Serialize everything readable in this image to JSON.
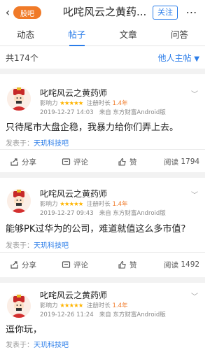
{
  "header": {
    "back_icon": "‹",
    "app_name": "股吧",
    "title": "叱咤风云之黄药...",
    "follow_label": "关注",
    "more_icon": "⋯"
  },
  "tabs": [
    "动态",
    "帖子",
    "文章",
    "问答"
  ],
  "active_tab": 1,
  "count_text": "共174个",
  "others_text": "他人主帖",
  "posts": [
    {
      "username": "叱咤风云之黄药师",
      "influence_label": "影响力",
      "stars": "★★★★★",
      "register_label": "注册时长",
      "register_value": "1.4年",
      "datetime": "2019-12-27 14:03",
      "source": "来自 东方财富Android版",
      "content": "只待尾市大盘企稳，我暴力给你们弄上去。",
      "from_label": "发表于：",
      "bar_name": "天玑科技吧",
      "share_label": "分享",
      "comment_label": "评论",
      "like_label": "赞",
      "read_label": "阅读",
      "read_count": "1794"
    },
    {
      "username": "叱咤风云之黄药师",
      "influence_label": "影响力",
      "stars": "★★★★★",
      "register_label": "注册时长",
      "register_value": "1.4年",
      "datetime": "2019-12-27 09:43",
      "source": "来自 东方财富Android版",
      "content": "能够PK过华为的公司，难道就值这么多市值?",
      "from_label": "发表于：",
      "bar_name": "天玑科技吧",
      "share_label": "分享",
      "comment_label": "评论",
      "like_label": "赞",
      "read_label": "阅读",
      "read_count": "1492"
    },
    {
      "username": "叱咤风云之黄药师",
      "influence_label": "影响力",
      "stars": "★★★★★",
      "register_label": "注册时长",
      "register_value": "1.4年",
      "datetime": "2019-12-26 11:24",
      "source": "来自 东方财富Android版",
      "content": "逗你玩，",
      "from_label": "发表于：",
      "bar_name": "天玑科技吧"
    }
  ],
  "colors": {
    "accent": "#2b7de9",
    "brand": "#f07a28",
    "stars": "#ffb400"
  },
  "icons": [
    "back-icon",
    "share-icon",
    "comment-icon",
    "like-icon",
    "chevron-down-icon",
    "more-icon"
  ]
}
